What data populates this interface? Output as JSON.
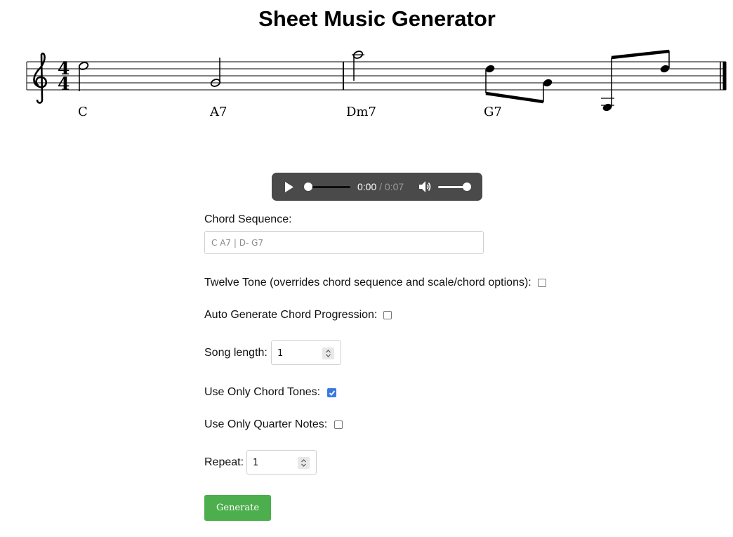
{
  "page": {
    "title": "Sheet Music Generator"
  },
  "score": {
    "clef": "treble",
    "time_signature": {
      "top": "4",
      "bottom": "4"
    },
    "chords": [
      "C",
      "A7",
      "Dm7",
      "G7"
    ]
  },
  "audio": {
    "current": "0:00",
    "separator": " / ",
    "duration": "0:07"
  },
  "form": {
    "chord_sequence": {
      "label": "Chord Sequence:",
      "placeholder": "C A7 | D- G7"
    },
    "twelve_tone": {
      "label": "Twelve Tone (overrides chord sequence and scale/chord options):",
      "checked": false
    },
    "auto_generate": {
      "label": "Auto Generate Chord Progression:",
      "checked": false
    },
    "song_length": {
      "label": "Song length:",
      "value": "1"
    },
    "chord_tones": {
      "label": "Use Only Chord Tones:",
      "checked": true
    },
    "quarter_notes": {
      "label": "Use Only Quarter Notes:",
      "checked": false
    },
    "repeat": {
      "label": "Repeat:",
      "value": "1"
    },
    "generate_label": "Generate"
  },
  "colors": {
    "checkbox_checked": "#3a79df",
    "button": "#4cae4c",
    "player": "#4a4a4a"
  }
}
